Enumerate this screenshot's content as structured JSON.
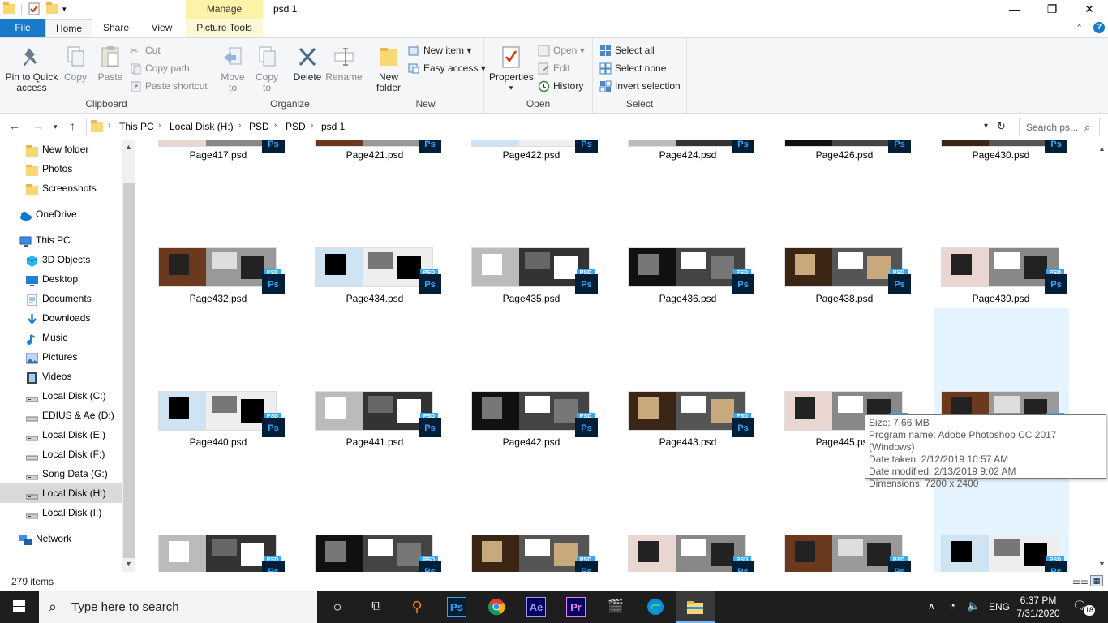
{
  "window": {
    "title": "psd 1",
    "contextual_tab": "Manage",
    "minimize": "—",
    "maximize": "❐",
    "close": "✕"
  },
  "tabs": [
    "File",
    "Home",
    "Share",
    "View",
    "Picture Tools"
  ],
  "ribbon": {
    "clipboard": {
      "label": "Clipboard",
      "pin": "Pin to Quick access",
      "copy": "Copy",
      "paste": "Paste",
      "cut": "Cut",
      "copy_path": "Copy path",
      "paste_shortcut": "Paste shortcut"
    },
    "organize": {
      "label": "Organize",
      "move_to": "Move to",
      "copy_to": "Copy to",
      "delete": "Delete",
      "rename": "Rename"
    },
    "new": {
      "label": "New",
      "new_folder": "New folder",
      "new_item": "New item",
      "easy_access": "Easy access"
    },
    "open": {
      "label": "Open",
      "properties": "Properties",
      "open": "Open",
      "edit": "Edit",
      "history": "History"
    },
    "select": {
      "label": "Select",
      "select_all": "Select all",
      "select_none": "Select none",
      "invert": "Invert selection"
    }
  },
  "address": {
    "crumbs": [
      "This PC",
      "Local Disk (H:)",
      "PSD",
      "PSD",
      "psd 1"
    ],
    "search_placeholder": "Search ps..."
  },
  "navpane": {
    "items": [
      {
        "label": "New folder",
        "icon": "folder-icon"
      },
      {
        "label": "Photos",
        "icon": "folder-icon"
      },
      {
        "label": "Screenshots",
        "icon": "folder-icon"
      },
      {
        "label": "OneDrive",
        "icon": "cloud-icon"
      },
      {
        "label": "This PC",
        "icon": "computer-icon"
      },
      {
        "label": "3D Objects",
        "icon": "cube-icon"
      },
      {
        "label": "Desktop",
        "icon": "desktop-icon"
      },
      {
        "label": "Documents",
        "icon": "document-icon"
      },
      {
        "label": "Downloads",
        "icon": "download-icon"
      },
      {
        "label": "Music",
        "icon": "music-icon"
      },
      {
        "label": "Pictures",
        "icon": "picture-icon"
      },
      {
        "label": "Videos",
        "icon": "video-icon"
      },
      {
        "label": "Local Disk (C:)",
        "icon": "drive-icon"
      },
      {
        "label": "EDIUS & Ae (D:)",
        "icon": "drive-icon"
      },
      {
        "label": "Local Disk (E:)",
        "icon": "drive-icon"
      },
      {
        "label": "Local Disk (F:)",
        "icon": "drive-icon"
      },
      {
        "label": "Song Data (G:)",
        "icon": "drive-icon"
      },
      {
        "label": "Local Disk (H:)",
        "icon": "drive-icon"
      },
      {
        "label": "Local Disk (I:)",
        "icon": "drive-icon"
      },
      {
        "label": "Network",
        "icon": "network-icon"
      }
    ]
  },
  "files": {
    "row1": [
      "Page417.psd",
      "Page421.psd",
      "Page422.psd",
      "Page424.psd",
      "Page426.psd",
      "Page430.psd"
    ],
    "row2": [
      "Page432.psd",
      "Page434.psd",
      "Page435.psd",
      "Page436.psd",
      "Page438.psd",
      "Page439.psd"
    ],
    "row3": [
      "Page440.psd",
      "Page441.psd",
      "Page442.psd",
      "Page443.psd",
      "Page445.psd",
      ""
    ],
    "row4": [
      "",
      "",
      "",
      "",
      "",
      ""
    ],
    "badge_text": "Ps",
    "tag_text": "PSD"
  },
  "tooltip": {
    "size": "Size: 7.66 MB",
    "program": "Program name: Adobe Photoshop CC 2017 (Windows)",
    "taken": "Date taken: 2/12/2019 10:57 AM",
    "modified": "Date modified: 2/13/2019 9:02 AM",
    "dimensions": "Dimensions: 7200 x 2400"
  },
  "status": {
    "item_count": "279 items"
  },
  "taskbar": {
    "search_text": "Type here to search",
    "language": "ENG",
    "time": "6:37 PM",
    "date": "7/31/2020",
    "notifications": "18",
    "apps": [
      "Ps",
      "Ae",
      "Pr"
    ]
  },
  "colors": {
    "accent": "#1979ca",
    "ribbon_bg": "#f5f6f7",
    "manage_tab": "#faf3a8",
    "selection": "#cce8ff",
    "taskbar": "#1e1e1e",
    "ps_blue": "#31a8ff",
    "ps_dark": "#001e36"
  }
}
